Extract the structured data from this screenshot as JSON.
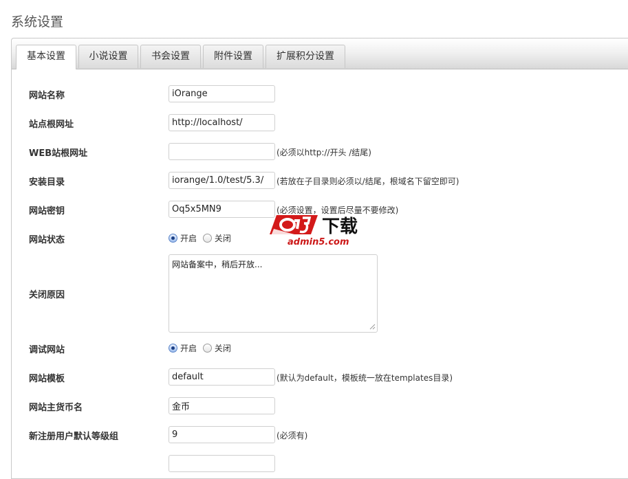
{
  "page": {
    "title": "系统设置"
  },
  "tabs": [
    {
      "label": "基本设置",
      "active": true
    },
    {
      "label": "小说设置",
      "active": false
    },
    {
      "label": "书会设置",
      "active": false
    },
    {
      "label": "附件设置",
      "active": false
    },
    {
      "label": "扩展积分设置",
      "active": false
    }
  ],
  "form": {
    "site_name": {
      "label": "网站名称",
      "value": "iOrange"
    },
    "site_root": {
      "label": "站点根网址",
      "value": "http://localhost/"
    },
    "web_root": {
      "label": "WEB站根网址",
      "value": "",
      "hint": "(必须以http://开头 /结尾)"
    },
    "install_dir": {
      "label": "安装目录",
      "value": "iorange/1.0/test/5.3/",
      "hint": "(若放在子目录则必须以/结尾，根域名下留空即可)"
    },
    "site_key": {
      "label": "网站密钥",
      "value": "Oq5x5MN9",
      "hint": "(必须设置，设置后尽量不要修改)"
    },
    "site_status": {
      "label": "网站状态",
      "on": "开启",
      "off": "关闭",
      "selected": "on"
    },
    "close_reason": {
      "label": "关闭原因",
      "value": "网站备案中，稍后开放..."
    },
    "debug": {
      "label": "调试网站",
      "on": "开启",
      "off": "关闭",
      "selected": "on"
    },
    "template": {
      "label": "网站模板",
      "value": "default",
      "hint": "(默认为default，模板统一放在templates目录)"
    },
    "currency": {
      "label": "网站主货币名",
      "value": "金币"
    },
    "default_group": {
      "label": "新注册用户默认等级组",
      "value": "9",
      "hint": "(必须有)"
    }
  },
  "watermark": {
    "brand": "a5下载",
    "sub": "admin5.com",
    "brand_color": "#cc1818"
  }
}
